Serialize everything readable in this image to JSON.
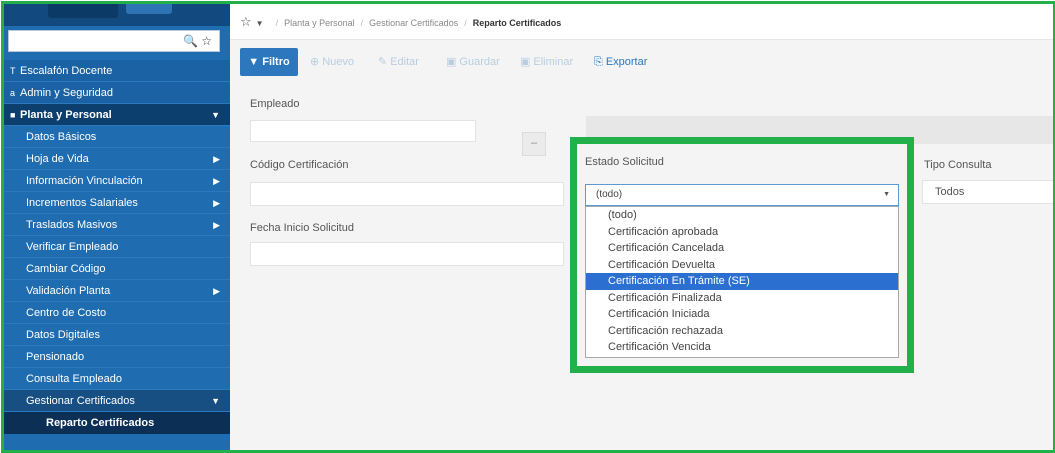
{
  "sidebar": {
    "menu": [
      {
        "label": "Escalafón Docente",
        "prefix": "T"
      },
      {
        "label": "Admin y Seguridad",
        "prefix": "a"
      },
      {
        "label": "Planta y Personal",
        "prefix": "■"
      }
    ],
    "submenu": [
      {
        "label": "Datos Básicos",
        "chevron": false
      },
      {
        "label": "Hoja de Vida",
        "chevron": true
      },
      {
        "label": "Información Vinculación",
        "chevron": true
      },
      {
        "label": "Incrementos Salariales",
        "chevron": true
      },
      {
        "label": "Traslados Masivos",
        "chevron": true
      },
      {
        "label": "Verificar Empleado",
        "chevron": false
      },
      {
        "label": "Cambiar Código",
        "chevron": false
      },
      {
        "label": "Validación Planta",
        "chevron": true
      },
      {
        "label": "Centro de Costo",
        "chevron": false
      },
      {
        "label": "Datos Digitales",
        "chevron": false
      },
      {
        "label": "Pensionado",
        "chevron": false
      },
      {
        "label": "Consulta Empleado",
        "chevron": false
      },
      {
        "label": "Gestionar Certificados",
        "chevron": true
      }
    ],
    "active_item": "Reparto Certificados"
  },
  "breadcrumb": {
    "items": [
      "Planta y Personal",
      "Gestionar Certificados"
    ],
    "current": "Reparto Certificados"
  },
  "toolbar": {
    "filter": "Filtro",
    "nuevo": "Nuevo",
    "editar": "Editar",
    "guardar": "Guardar",
    "eliminar": "Eliminar",
    "exportar": "Exportar"
  },
  "form": {
    "empleado_label": "Empleado",
    "codigo_label": "Código Certificación",
    "fecha_label": "Fecha Inicio Solicitud",
    "estado_label": "Estado Solicitud",
    "estado_value": "(todo)",
    "estado_options": [
      "(todo)",
      "Certificación aprobada",
      "Certificación Cancelada",
      "Certificación Devuelta",
      "Certificación En Trámite (SE)",
      "Certificación Finalizada",
      "Certificación Iniciada",
      "Certificación rechazada",
      "Certificación Vencida"
    ],
    "estado_selected_index": 4,
    "tipo_label": "Tipo Consulta",
    "tipo_value": "Todos"
  },
  "colors": {
    "highlight": "#22b04a",
    "sidebar": "#1f6cb0",
    "primary": "#2c77bd",
    "selected_option": "#2b70d1"
  }
}
